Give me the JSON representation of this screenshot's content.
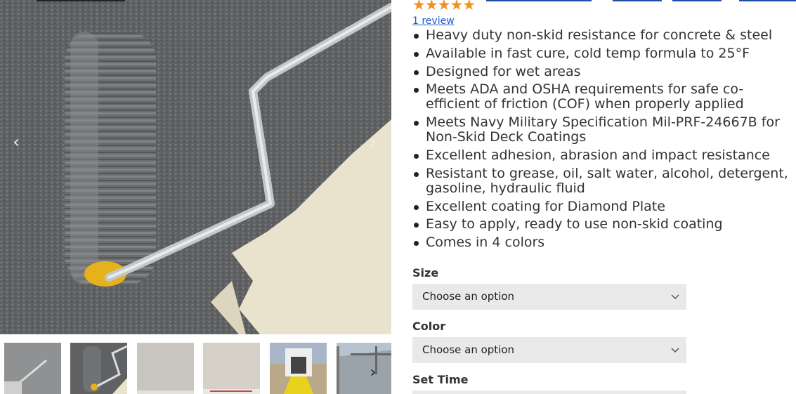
{
  "product": {
    "rating_stars": "★★★★★",
    "review_link": "1 review",
    "features": [
      "Heavy duty non-skid resistance for concrete & steel",
      "Available in fast cure, cold temp formula to 25°F",
      "Designed for wet areas",
      "Meets ADA and OSHA requirements for safe co-efficient of friction (COF) when properly applied",
      "Meets Navy Military Specification Mil-PRF-24667B for Non-Skid Deck Coatings",
      "Excellent adhesion, abrasion and impact resistance",
      "Resistant to grease, oil, salt water, alcohol, detergent, gasoline, hydraulic fluid",
      "Excellent coating for Diamond Plate",
      "Easy to apply, ready to use non-skid coating",
      "Comes in 4 colors"
    ]
  },
  "options": {
    "size_label": "Size",
    "size_value": "Choose an option",
    "color_label": "Color",
    "color_value": "Choose an option",
    "set_time_label": "Set Time"
  },
  "gallery": {
    "prev_glyph": "‹",
    "next_glyph": "›",
    "thumbs_next_glyph": "›"
  },
  "colors": {
    "star": "#f0921e",
    "link": "#1a5bd4",
    "select_bg": "#e9e9e9",
    "accent_blue": "#1f4fa6"
  }
}
